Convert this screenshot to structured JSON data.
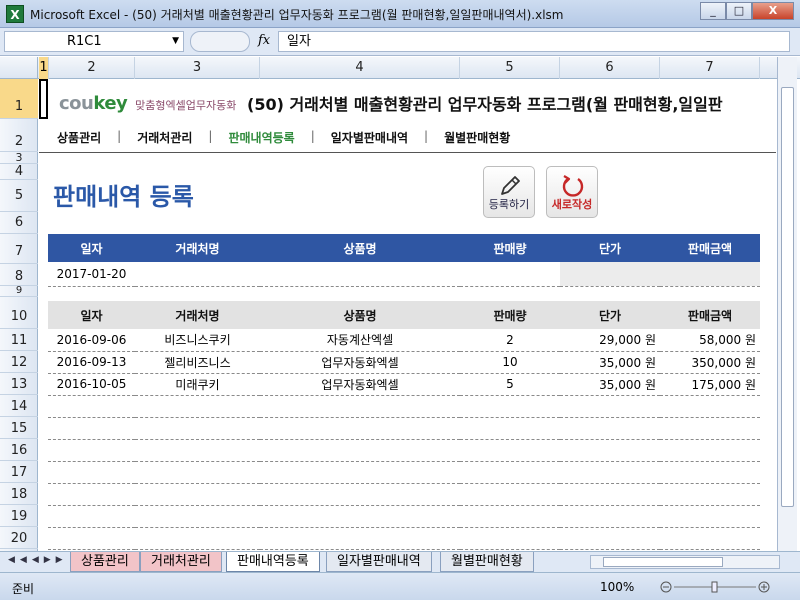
{
  "window": {
    "title": "Microsoft Excel - (50) 거래처별 매출현황관리 업무자동화 프로그램(월 판매현황,일일판매내역서).xlsm",
    "buttons": [
      "_",
      "□",
      "X"
    ]
  },
  "formula_bar": {
    "name_box": "R1C1",
    "fx": "fx",
    "value": "일자"
  },
  "columns": [
    "1",
    "2",
    "3",
    "4",
    "5",
    "6",
    "7"
  ],
  "rows": [
    "1",
    "2",
    "3",
    "4",
    "5",
    "6",
    "7",
    "8",
    "9",
    "10",
    "11",
    "12",
    "13",
    "14",
    "15",
    "16",
    "17",
    "18",
    "19",
    "20"
  ],
  "logo": {
    "co": "cou",
    "key": "key",
    "tagline": "맞춤형엑셀업무자동화"
  },
  "sheet_title": "(50) 거래처별 매출현황관리 업무자동화 프로그램(월 판매현황,일일판",
  "menu": [
    "상품관리",
    "거래처관리",
    "판매내역등록",
    "일자별판매내역",
    "월별판매현황"
  ],
  "active_menu": "판매내역등록",
  "page_title": "판매내역 등록",
  "actions": {
    "register": "등록하기",
    "new": "새로작성"
  },
  "entry": {
    "headers": [
      "일자",
      "거래처명",
      "상품명",
      "판매량",
      "단가",
      "판매금액"
    ],
    "row": [
      "2017-01-20",
      "",
      "",
      "",
      "",
      ""
    ]
  },
  "list": {
    "headers": [
      "일자",
      "거래처명",
      "상품명",
      "판매량",
      "단가",
      "판매금액"
    ],
    "rows": [
      [
        "2016-09-06",
        "비즈니스쿠키",
        "자동계산엑셀",
        "2",
        "29,000 원",
        "58,000 원"
      ],
      [
        "2016-09-13",
        "젤리비즈니스",
        "업무자동화엑셀",
        "10",
        "35,000 원",
        "350,000 원"
      ],
      [
        "2016-10-05",
        "미래쿠키",
        "업무자동화엑셀",
        "5",
        "35,000 원",
        "175,000 원"
      ]
    ]
  },
  "sheet_tabs": [
    "상품관리",
    "거래처관리",
    "판매내역등록",
    "일자별판매내역",
    "월별판매현황"
  ],
  "active_tab": "판매내역등록",
  "status": {
    "ready": "준비",
    "zoom": "100%"
  }
}
